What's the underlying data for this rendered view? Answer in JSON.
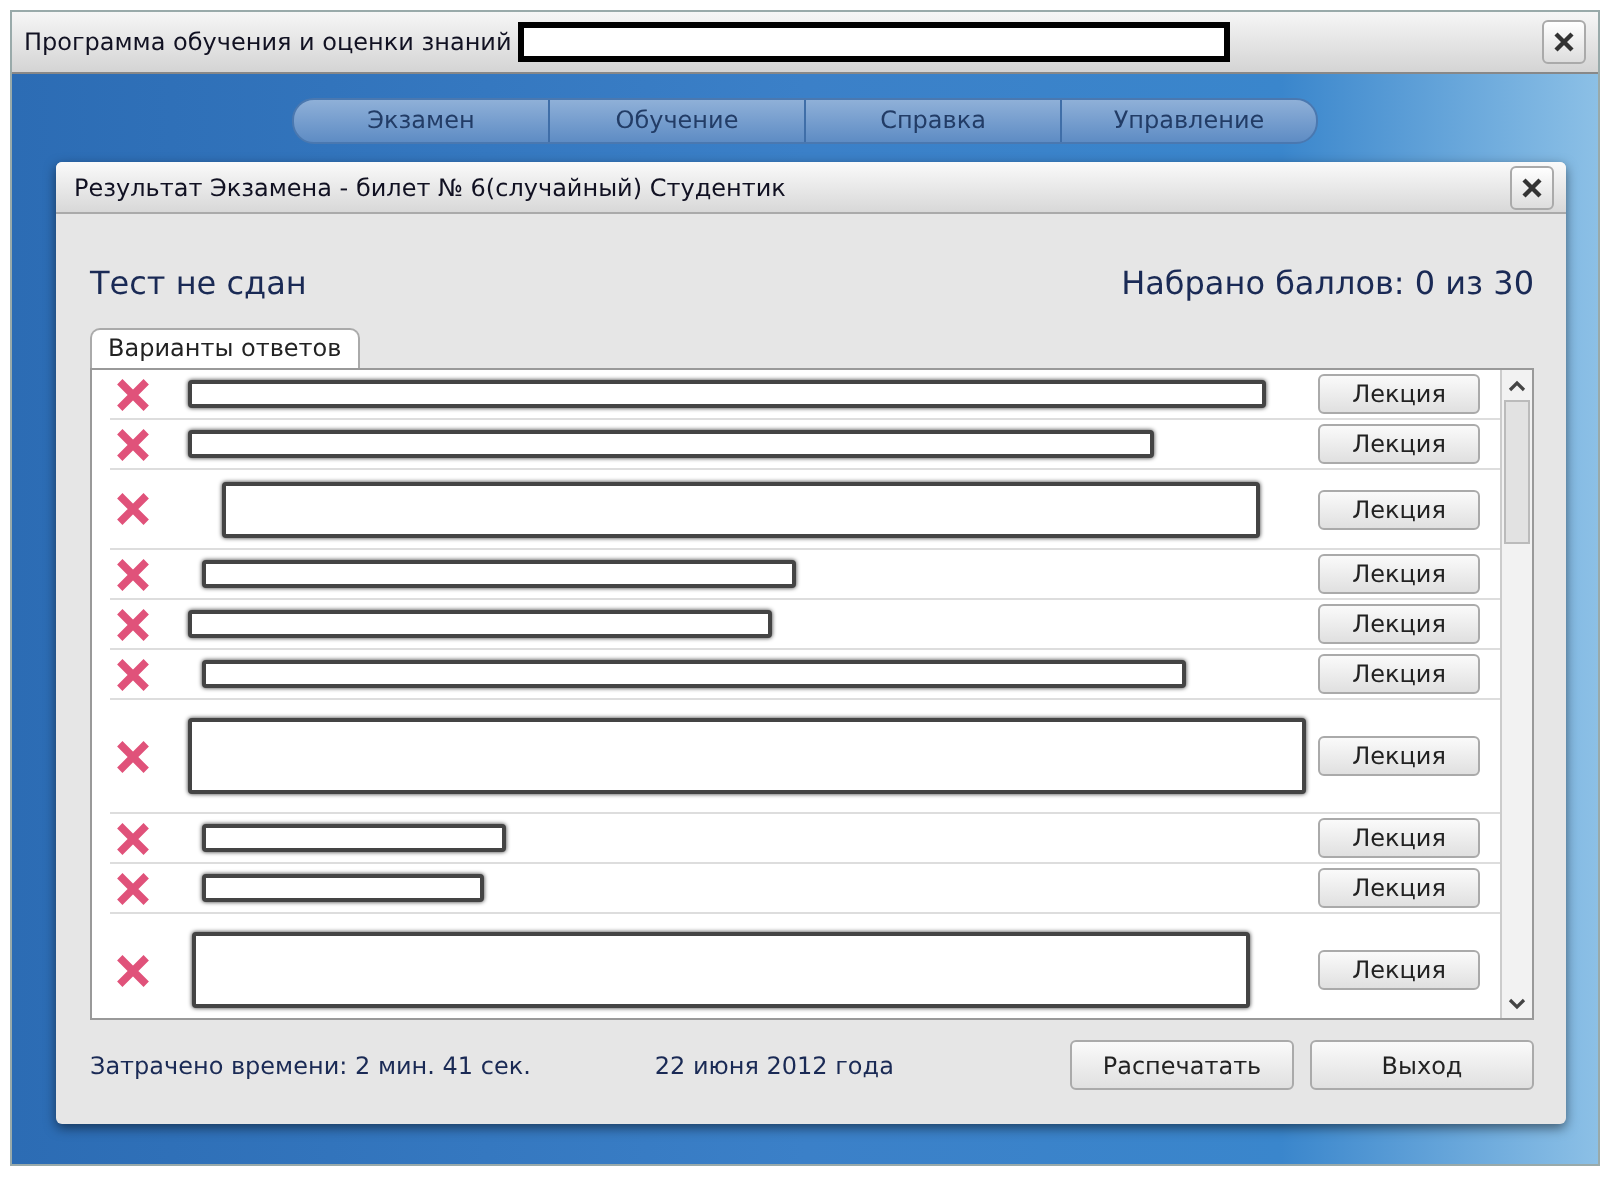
{
  "window": {
    "title": "Программа обучения и оценки знаний"
  },
  "menu": [
    {
      "label": "Экзамен"
    },
    {
      "label": "Обучение"
    },
    {
      "label": "Справка"
    },
    {
      "label": "Управление"
    }
  ],
  "dialog": {
    "title": "Результат Экзамена - билет № 6(случайный) Студентик",
    "result": "Тест не сдан",
    "score": "Набрано баллов: 0 из 30",
    "tabs": [
      {
        "label": "Варианты ответов",
        "selected": true
      }
    ],
    "answers": [
      {
        "kind": "single",
        "correct": false,
        "button": "Лекция"
      },
      {
        "kind": "single",
        "correct": false,
        "button": "Лекция"
      },
      {
        "kind": "double",
        "correct": false,
        "button": "Лекция"
      },
      {
        "kind": "single",
        "correct": false,
        "button": "Лекция"
      },
      {
        "kind": "single",
        "correct": false,
        "button": "Лекция"
      },
      {
        "kind": "single",
        "correct": false,
        "button": "Лекция"
      },
      {
        "kind": "triple",
        "correct": false,
        "button": "Лекция"
      },
      {
        "kind": "single",
        "correct": false,
        "button": "Лекция"
      },
      {
        "kind": "single",
        "correct": false,
        "button": "Лекция"
      },
      {
        "kind": "triple",
        "correct": false,
        "button": "Лекция"
      }
    ],
    "time_spent": "Затрачено времени: 2 мин. 41 сек.",
    "date": "22 июня 2012 года",
    "buttons": [
      {
        "label": "Распечатать"
      },
      {
        "label": "Выход"
      }
    ]
  }
}
